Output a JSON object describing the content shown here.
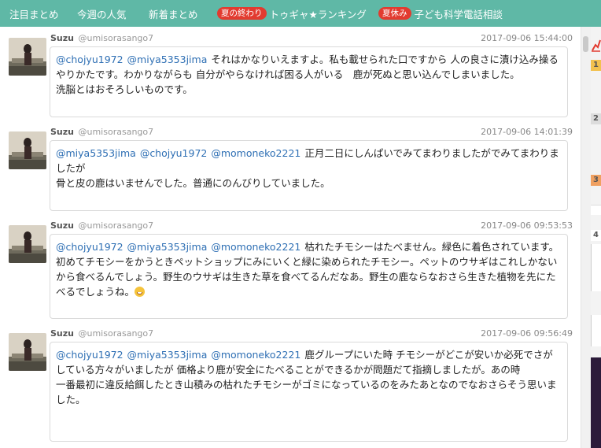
{
  "nav": {
    "items": [
      {
        "label": "注目まとめ",
        "badge": ""
      },
      {
        "label": "今週の人気",
        "badge": ""
      },
      {
        "label": "新着まとめ",
        "badge": ""
      },
      {
        "label": "トゥギャ★ランキング",
        "badge": "夏の終わり"
      },
      {
        "label": "子ども科学電話相談",
        "badge": "夏休み"
      }
    ]
  },
  "tweets": [
    {
      "name": "Suzu",
      "handle": "@umisorasango7",
      "time": "2017-09-06 15:44:00",
      "mentions": [
        "@chojyu1972",
        "@miya5353jima"
      ],
      "lines": [
        "それはかなりいえますよ。私も載せられた口ですから 人の良さに漬け込み操るやりかたです。わかりながらも 自分がやらなければ困る人がいる　鹿が死ぬと思い込んでしまいました。",
        "洗脳とはおそろしいものです。"
      ]
    },
    {
      "name": "Suzu",
      "handle": "@umisorasango7",
      "time": "2017-09-06 14:01:39",
      "mentions": [
        "@miya5353jima",
        "@chojyu1972",
        "@momoneko2221"
      ],
      "lines": [
        "正月二日にしんぱいでみてまわりましたがでみてまわりましたが",
        "骨と皮の鹿はいませんでした。普通にのんびりしていました。"
      ]
    },
    {
      "name": "Suzu",
      "handle": "@umisorasango7",
      "time": "2017-09-06 09:53:53",
      "mentions": [
        "@chojyu1972",
        "@miya5353jima",
        "@momoneko2221"
      ],
      "lines": [
        "枯れたチモシーはたべません。緑色に着色されています。初めてチモシーをかうときペットショップにみにいくと緑に染められたチモシー。ペットのウサギはこれしかないから食べるんでしょう。野生のウサギは生きた草を食べてるんだなあ。野生の鹿ならなおさら生きた植物を先にたべるでしょうね。"
      ],
      "emoji": "grinning-emoji"
    },
    {
      "name": "Suzu",
      "handle": "@umisorasango7",
      "time": "2017-09-06 09:56:49",
      "mentions": [
        "@chojyu1972",
        "@miya5353jima",
        "@momoneko2221"
      ],
      "lines": [
        "鹿グループにいた時 チモシーがどこが安いか必死でさがしている方々がいましたが 価格より鹿が安全にたべることができるかが問題だて指摘しましたが。あの時",
        "一番最初に違反給餌したとき山積みの枯れたチモシーがゴミになっているのをみたあとなのでなおさらそう思いました。"
      ]
    }
  ],
  "sidebar": {
    "ranks": [
      "1",
      "2",
      "3",
      "4"
    ]
  },
  "colors": {
    "nav_bg": "#5fb8a6",
    "badge_bg": "#e23b30",
    "mention": "#2e6fb4"
  }
}
